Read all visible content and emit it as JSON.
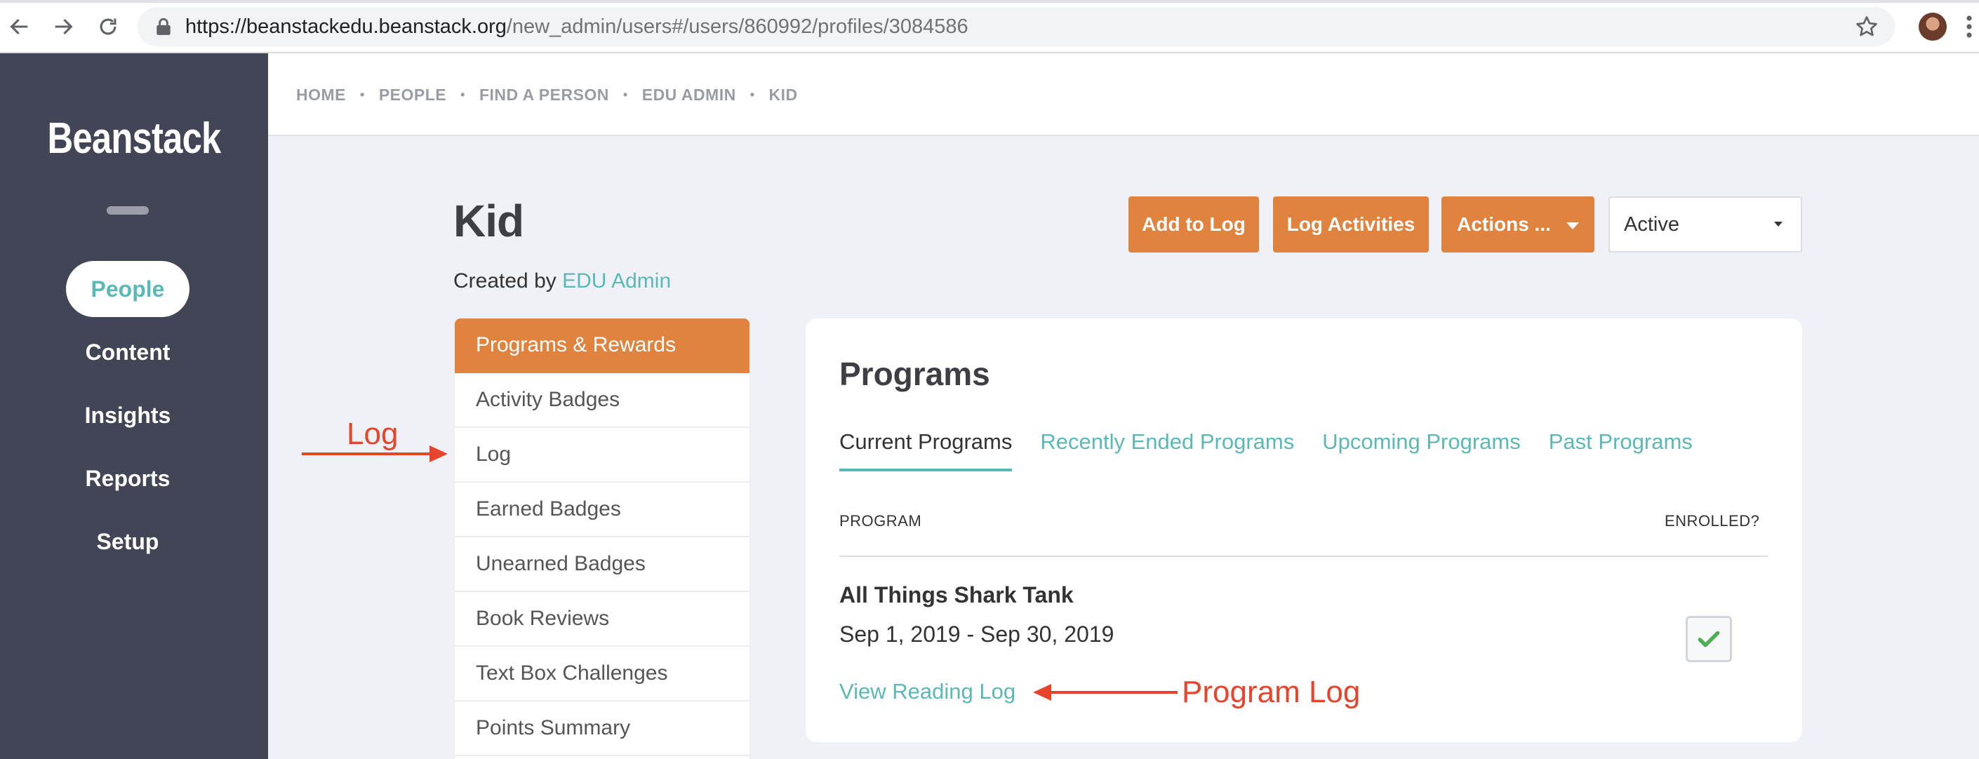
{
  "browser": {
    "url_host": "https://beanstackedu.beanstack.org",
    "url_path": "/new_admin/users#/users/860992/profiles/3084586"
  },
  "sidebar": {
    "brand": "Beanstack",
    "items": [
      {
        "label": "People",
        "active": true
      },
      {
        "label": "Content",
        "active": false
      },
      {
        "label": "Insights",
        "active": false
      },
      {
        "label": "Reports",
        "active": false
      },
      {
        "label": "Setup",
        "active": false
      }
    ]
  },
  "breadcrumb": [
    "HOME",
    "PEOPLE",
    "FIND A PERSON",
    "EDU ADMIN",
    "KID"
  ],
  "header": {
    "title": "Kid",
    "created_prefix": "Created by ",
    "created_by": "EDU Admin",
    "buttons": {
      "add_to_log": "Add to Log",
      "log_activities": "Log Activities",
      "actions": "Actions ..."
    },
    "status": "Active"
  },
  "menu": [
    {
      "label": "Programs & Rewards",
      "active": true
    },
    {
      "label": "Activity Badges",
      "active": false
    },
    {
      "label": "Log",
      "active": false
    },
    {
      "label": "Earned Badges",
      "active": false
    },
    {
      "label": "Unearned Badges",
      "active": false
    },
    {
      "label": "Book Reviews",
      "active": false
    },
    {
      "label": "Text Box Challenges",
      "active": false
    },
    {
      "label": "Points Summary",
      "active": false
    }
  ],
  "programs": {
    "title": "Programs",
    "tabs": [
      {
        "label": "Current Programs",
        "active": true
      },
      {
        "label": "Recently Ended Programs",
        "active": false
      },
      {
        "label": "Upcoming Programs",
        "active": false
      },
      {
        "label": "Past Programs",
        "active": false
      }
    ],
    "columns": {
      "program": "PROGRAM",
      "enrolled": "ENROLLED?"
    },
    "rows": [
      {
        "name": "All Things Shark Tank",
        "dates": "Sep 1, 2019 - Sep 30, 2019",
        "link": "View Reading Log",
        "enrolled": true
      }
    ]
  },
  "annotations": {
    "log": "Log",
    "program_log": "Program Log"
  },
  "colors": {
    "accent_orange": "#e0833e",
    "accent_teal": "#5ab9b6",
    "sidebar_bg": "#414555",
    "annotation_red": "#e8442b"
  }
}
